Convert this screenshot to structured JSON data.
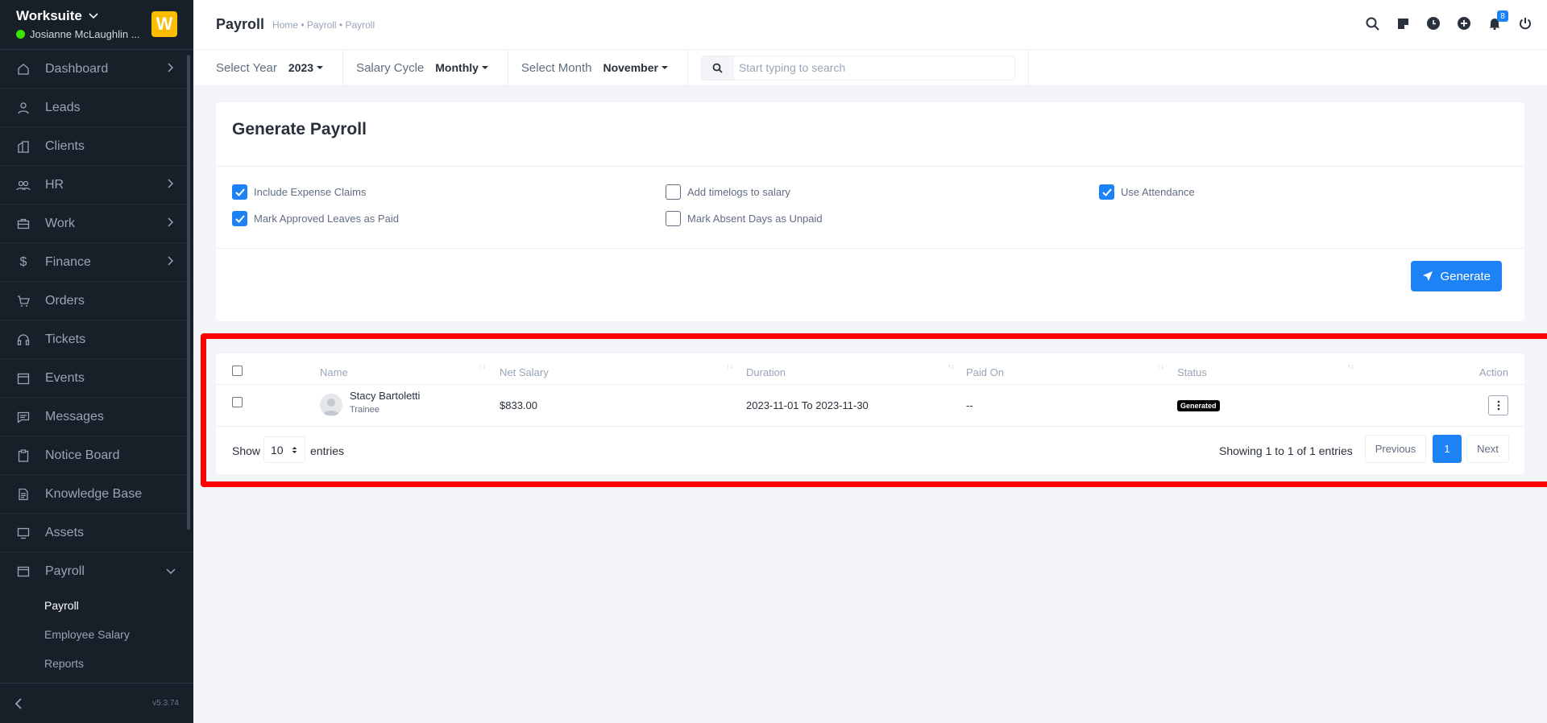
{
  "sidebar": {
    "brand": "Worksuite",
    "user": "Josianne McLaughlin ...",
    "logo_letter": "W",
    "version": "v5.3.74",
    "items": [
      {
        "label": "Dashboard",
        "icon": "home-icon"
      },
      {
        "label": "Leads",
        "icon": "user-icon"
      },
      {
        "label": "Clients",
        "icon": "building-icon"
      },
      {
        "label": "HR",
        "icon": "people-icon"
      },
      {
        "label": "Work",
        "icon": "briefcase-icon"
      },
      {
        "label": "Finance",
        "icon": "dollar-icon"
      },
      {
        "label": "Orders",
        "icon": "cart-icon"
      },
      {
        "label": "Tickets",
        "icon": "headset-icon"
      },
      {
        "label": "Events",
        "icon": "calendar-icon"
      },
      {
        "label": "Messages",
        "icon": "chat-icon"
      },
      {
        "label": "Notice Board",
        "icon": "clipboard-icon"
      },
      {
        "label": "Knowledge Base",
        "icon": "document-icon"
      },
      {
        "label": "Assets",
        "icon": "monitor-icon"
      },
      {
        "label": "Payroll",
        "icon": "wallet-icon"
      }
    ],
    "payroll_sub": [
      "Payroll",
      "Employee Salary",
      "Reports"
    ]
  },
  "header": {
    "title": "Payroll",
    "breadcrumb": "Home • Payroll • Payroll",
    "notification_count": "8"
  },
  "filters": {
    "year_label": "Select Year",
    "year_value": "2023",
    "cycle_label": "Salary Cycle",
    "cycle_value": "Monthly",
    "month_label": "Select Month",
    "month_value": "November",
    "search_placeholder": "Start typing to search"
  },
  "generate": {
    "title": "Generate Payroll",
    "options": [
      {
        "label": "Include Expense Claims",
        "checked": true
      },
      {
        "label": "Add timelogs to salary",
        "checked": false
      },
      {
        "label": "Use Attendance",
        "checked": true
      },
      {
        "label": "Mark Approved Leaves as Paid",
        "checked": true
      },
      {
        "label": "Mark Absent Days as Unpaid",
        "checked": false
      }
    ],
    "button_label": "Generate"
  },
  "table": {
    "columns": [
      "Name",
      "Net Salary",
      "Duration",
      "Paid On",
      "Status",
      "Action"
    ],
    "rows": [
      {
        "name": "Stacy Bartoletti",
        "designation": "Trainee",
        "net_salary": "$833.00",
        "duration": "2023-11-01 To 2023-11-30",
        "paid_on": "--",
        "status": "Generated"
      }
    ],
    "show_label": "Show",
    "page_length": "10",
    "entries_label": "entries",
    "info": "Showing 1 to 1 of 1 entries",
    "prev_label": "Previous",
    "current_page": "1",
    "next_label": "Next"
  }
}
